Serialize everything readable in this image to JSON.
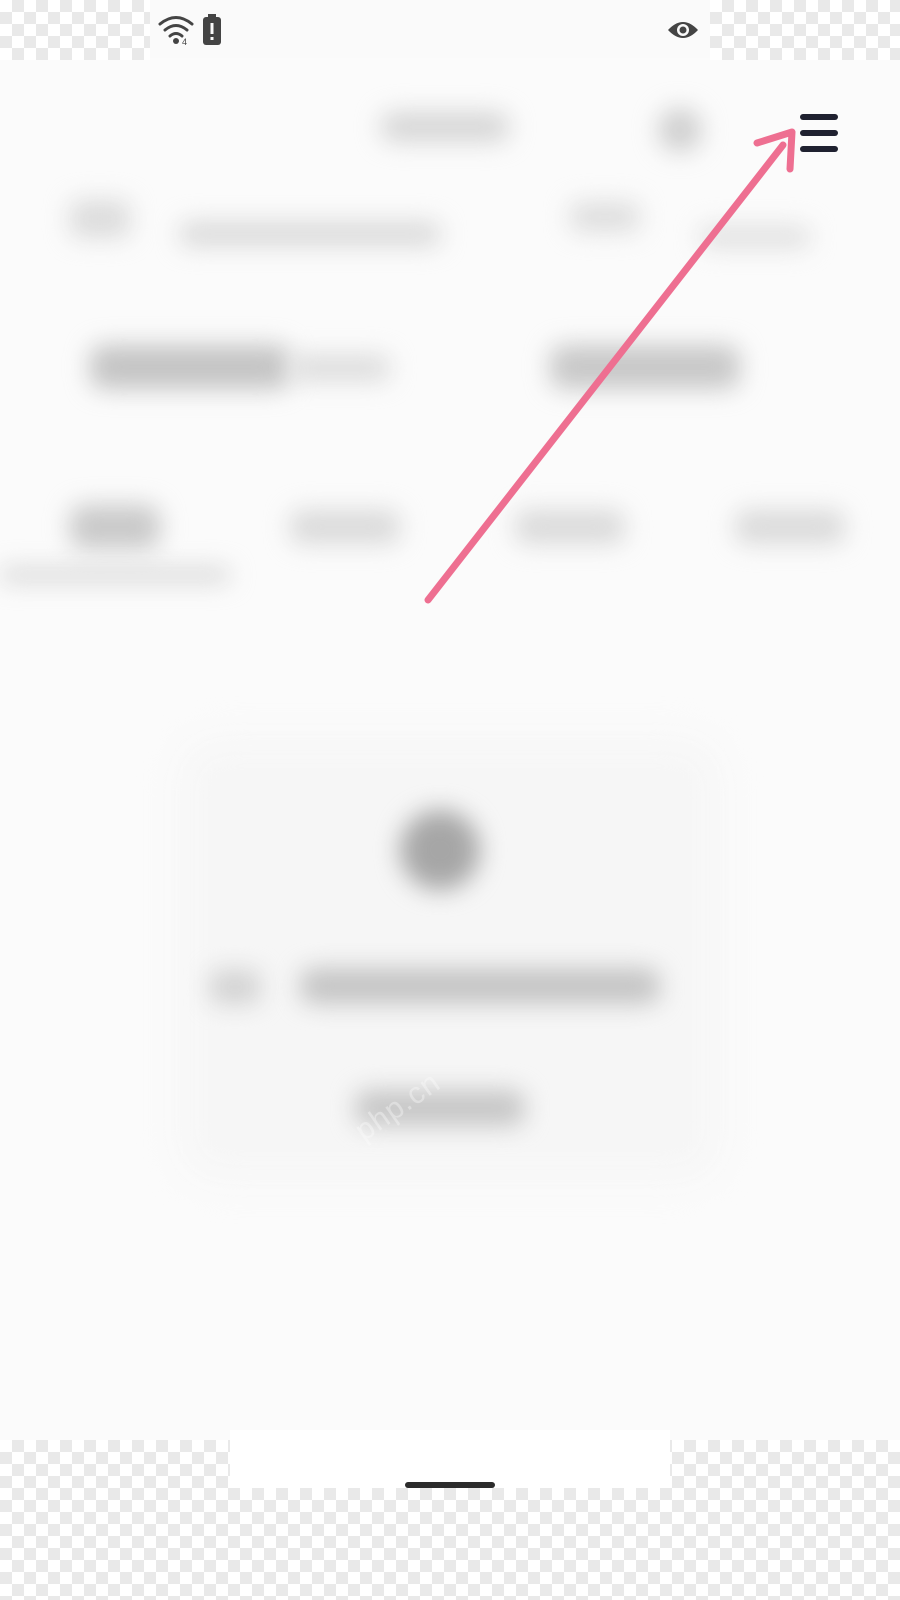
{
  "status_bar": {
    "icons": [
      "wifi-icon",
      "battery-alert-icon",
      "eye-icon"
    ]
  },
  "header": {
    "menu_icon": "hamburger-menu-icon"
  },
  "annotation": {
    "arrow_color": "#ee6f91",
    "points_to": "hamburger-menu-icon"
  },
  "content": {
    "blurred": true
  },
  "watermark": {
    "text": "php.cn"
  },
  "colors": {
    "background": "#fbfbfb",
    "menu_icon": "#1f2130",
    "arrow": "#ee6f91"
  }
}
